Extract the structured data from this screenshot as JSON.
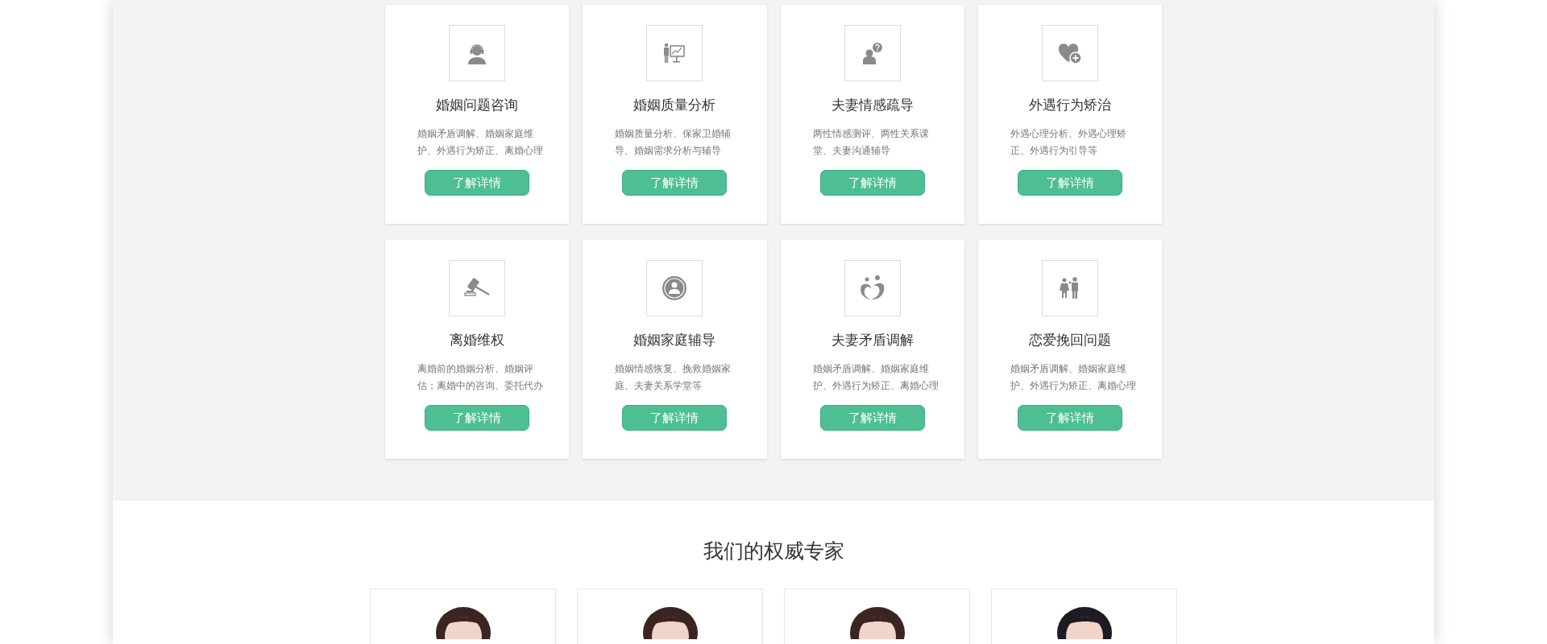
{
  "services": [
    {
      "kind": "headset",
      "title": "婚姻问题咨询",
      "desc": [
        "婚姻矛盾调解、婚姻家庭维",
        "护、外遇行为矫正、离婚心理"
      ],
      "button": "了解详情"
    },
    {
      "kind": "presenter",
      "title": "婚姻质量分析",
      "desc": [
        "婚姻质量分析、保家卫婚辅",
        "导、婚姻需求分析与辅导"
      ],
      "button": "了解详情"
    },
    {
      "kind": "question",
      "title": "夫妻情感疏导",
      "desc": [
        "两性情感测评、两性关系课",
        "堂、夫妻沟通辅导"
      ],
      "button": "了解详情"
    },
    {
      "kind": "heart",
      "title": "外遇行为矫治",
      "desc": [
        "外遇心理分析、外遇心理矫",
        "正、外遇行为引导等"
      ],
      "button": "了解详情"
    },
    {
      "kind": "gavel",
      "title": "离婚维权",
      "desc": [
        "离婚前的婚姻分析、婚姻评",
        "估；离婚中的咨询、委托代办"
      ],
      "button": "了解详情"
    },
    {
      "kind": "person-circle",
      "title": "婚姻家庭辅导",
      "desc": [
        "婚姻情感恢复、挽救婚姻家",
        "庭、夫妻关系学堂等"
      ],
      "button": "了解详情"
    },
    {
      "kind": "family",
      "title": "夫妻矛盾调解",
      "desc": [
        "婚姻矛盾调解、婚姻家庭维",
        "护、外遇行为矫正、离婚心理"
      ],
      "button": "了解详情"
    },
    {
      "kind": "couple",
      "title": "恋爱挽回问题",
      "desc": [
        "婚姻矛盾调解、婚姻家庭维",
        "护、外遇行为矫正、离婚心理"
      ],
      "button": "了解详情"
    }
  ],
  "experts_section": {
    "title": "我们的权威专家"
  }
}
